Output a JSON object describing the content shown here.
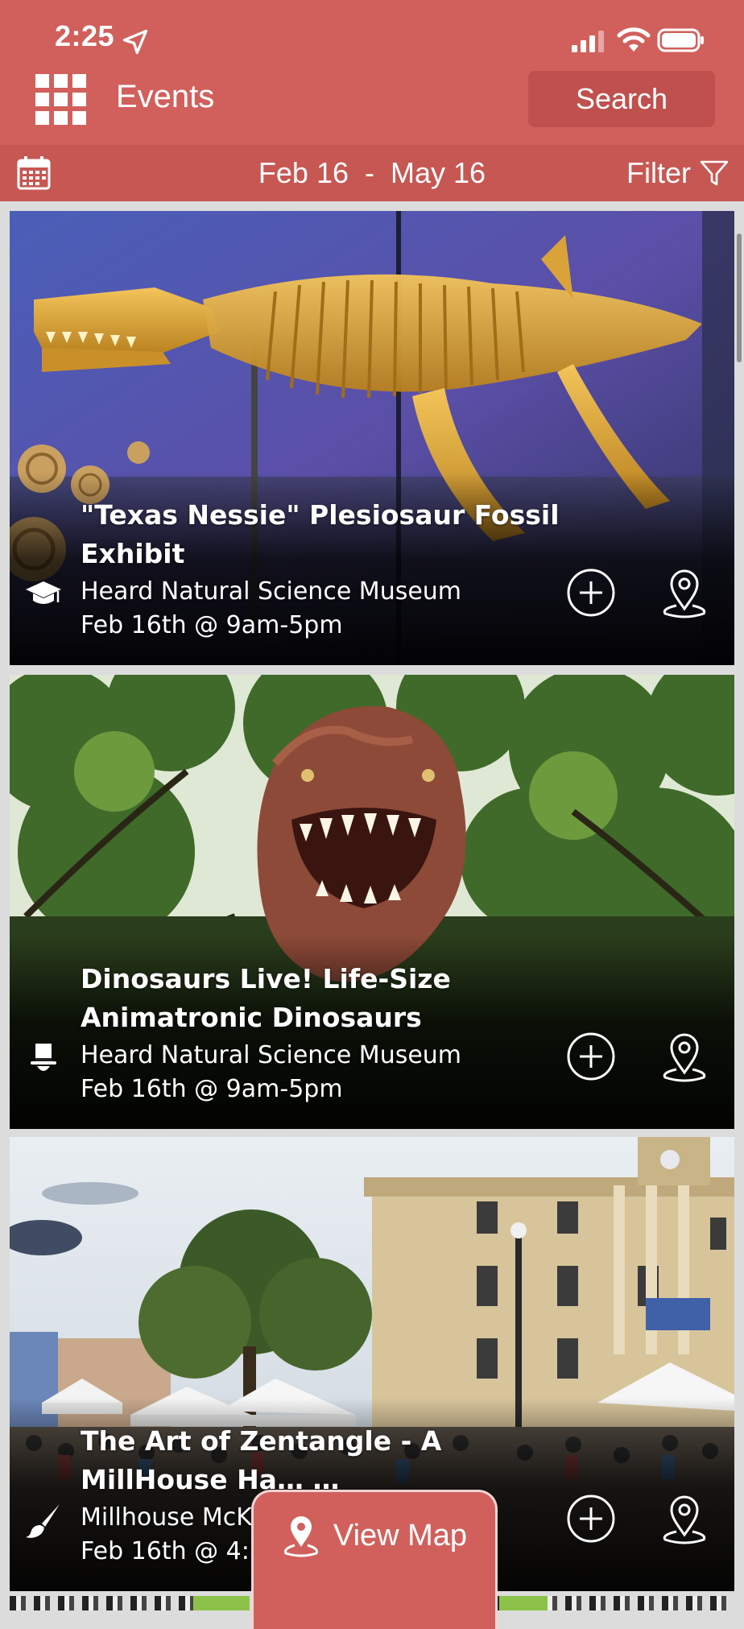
{
  "status": {
    "time": "2:25"
  },
  "header": {
    "title": "Events",
    "search_label": "Search"
  },
  "datebar": {
    "start": "Feb 16",
    "separator": "-",
    "end": "May 16",
    "range_text": "Feb 16  -  May 16",
    "filter_label": "Filter"
  },
  "events": [
    {
      "title_line1": "\"Texas Nessie\" Plesiosaur Fossil",
      "title_line2": "Exhibit",
      "venue": "Heard Natural Science Museum",
      "date": "Feb 16th @ 9am-5pm",
      "category_icon": "graduation-cap-icon"
    },
    {
      "title_line1": "Dinosaurs Live! Life-Size",
      "title_line2": "Animatronic Dinosaurs",
      "venue": "Heard Natural Science Museum",
      "date": "Feb 16th @ 9am-5pm",
      "category_icon": "top-hat-icon"
    },
    {
      "title_line1": "The Art of Zentangle - A",
      "title_line2": "MillHouse Ha… …",
      "venue": "Millhouse McK",
      "date": "Feb 16th @ 4:3",
      "category_icon": "paintbrush-icon"
    }
  ],
  "view_map": {
    "label": "View Map"
  },
  "colors": {
    "brand": "#d1605c",
    "brand_dark": "#c65753",
    "search_bg": "#c0504d"
  }
}
